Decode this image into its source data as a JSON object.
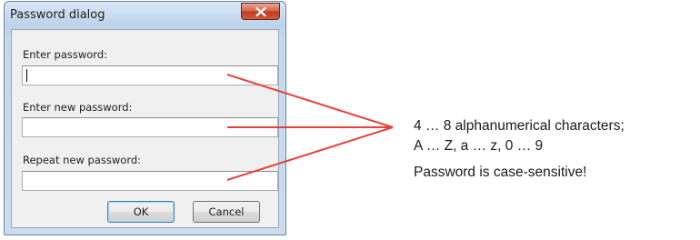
{
  "dialog": {
    "title": "Password dialog",
    "close_icon": "close-icon",
    "fields": [
      {
        "label": "Enter password:",
        "value": ""
      },
      {
        "label": "Enter new password:",
        "value": ""
      },
      {
        "label": "Repeat new password:",
        "value": ""
      }
    ],
    "ok_label": "OK",
    "cancel_label": "Cancel"
  },
  "annotations": {
    "rule_line1": "4 … 8 alphanumerical characters;",
    "rule_line2": "A … Z, a … z, 0 … 9",
    "case_note": "Password is case-sensitive!"
  },
  "colors": {
    "pointer_line": "#e8413a",
    "close_button": "#c7442a",
    "window_frame": "#bcd3ea"
  }
}
